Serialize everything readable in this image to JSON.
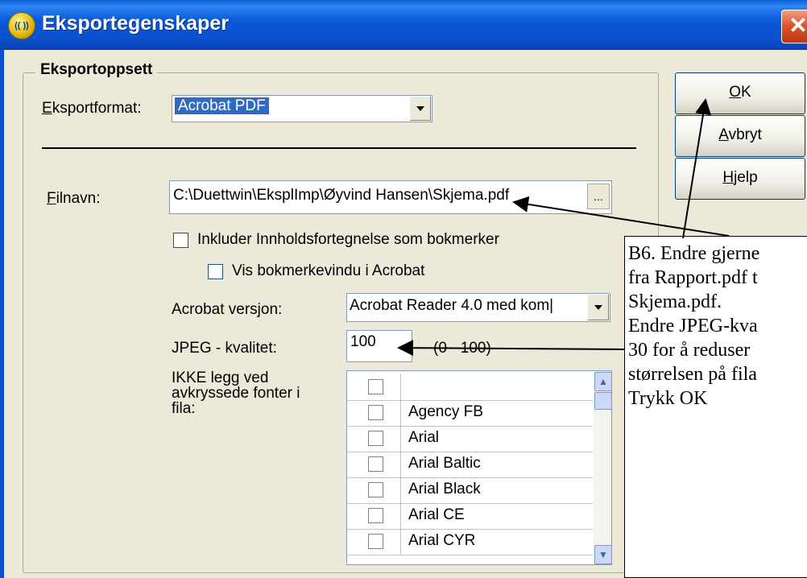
{
  "window": {
    "title": "Eksportegenskaper",
    "app_icon_text": "(( ))",
    "close_glyph": "✕"
  },
  "group": {
    "legend": "Eksportoppsett"
  },
  "export_format": {
    "label": "Eksportformat:",
    "value": "Acrobat PDF"
  },
  "filename": {
    "label": "Filnavn:",
    "value": "C:\\Duettwin\\EksplImp\\Øyvind Hansen\\Skjema.pdf",
    "browse": "..."
  },
  "options": {
    "include_toc": {
      "label": "Inkluder Innholdsfortegnelse som bokmerker",
      "checked": false
    },
    "show_bookmarks": {
      "label": "Vis bokmerkevindu i Acrobat",
      "checked": false
    }
  },
  "acrobat_version": {
    "label": "Acrobat versjon:",
    "value": "Acrobat Reader 4.0 med kom|"
  },
  "jpeg_quality": {
    "label": "JPEG - kvalitet:",
    "value": "100",
    "range": "(0 - 100)"
  },
  "fonts": {
    "label": "IKKE legg ved\navkryssede fonter i\nfila:",
    "items": [
      "",
      "Agency FB",
      "Arial",
      "Arial Baltic",
      "Arial Black",
      "Arial CE",
      "Arial CYR"
    ]
  },
  "buttons": {
    "ok": "OK",
    "cancel": "Avbryt",
    "help": "Hjelp"
  },
  "callout": {
    "text": "B6. Endre gjerne\nfra Rapport.pdf t\nSkjema.pdf.\nEndre JPEG-kva\n30 for å reduser\nstørrelsen på fila\nTrykk OK"
  },
  "colors": {
    "title_bar": "#0a50cc",
    "dialog_bg": "#ece9d8",
    "selection": "#316ac5",
    "close": "#d8522a"
  },
  "icons": {
    "dropdown": "chevron-down-icon",
    "scroll_up": "chevron-up-icon",
    "scroll_down": "chevron-down-icon"
  }
}
